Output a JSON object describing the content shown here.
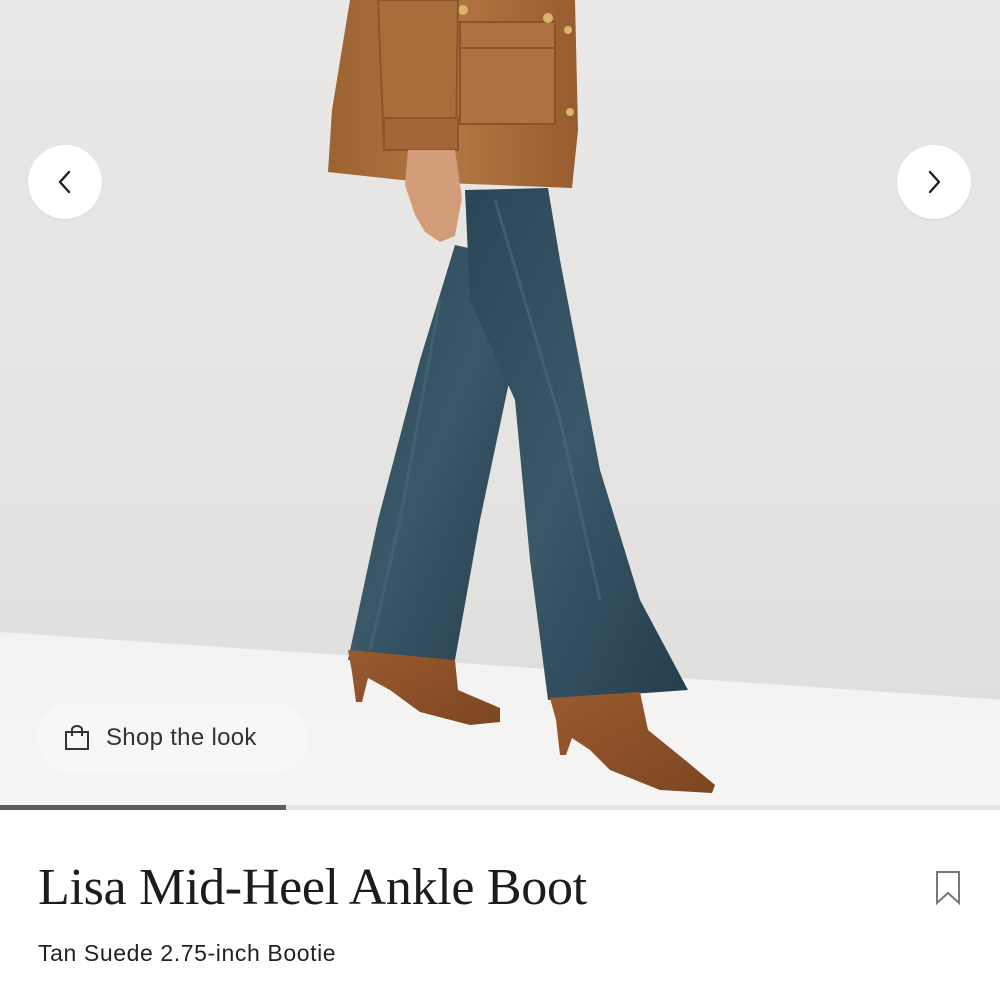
{
  "gallery": {
    "image_alt": "Model wearing tan suede jacket, dark flared jeans and tan suede pointed ankle boots",
    "prev_icon": "chevron-left-icon",
    "next_icon": "chevron-right-icon",
    "progress": 0.286,
    "shop_the_look": {
      "label": "Shop the look",
      "icon": "shopping-bag-icon"
    }
  },
  "product": {
    "title": "Lisa Mid-Heel Ankle Boot",
    "subtitle": "Tan Suede 2.75-inch Bootie",
    "bookmark_icon": "bookmark-icon"
  },
  "colors": {
    "text": "#1c1c1c",
    "progress": "#5e5e5e",
    "suede": "#a8683a",
    "denim": "#2d4555"
  }
}
